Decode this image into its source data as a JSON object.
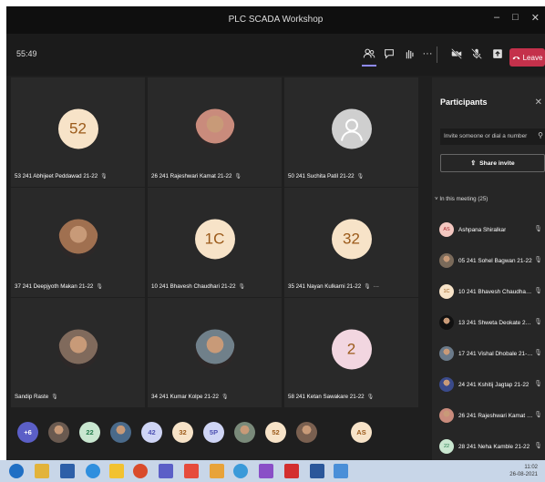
{
  "window": {
    "title": "PLC SCADA Workshop",
    "minimize": "–",
    "maximize": "□",
    "close": "✕"
  },
  "toolbar": {
    "timer": "55:49",
    "leave_label": "Leave"
  },
  "tiles": [
    {
      "label": "53 241 Abhijeet Peddawad 21-22",
      "initials": "52",
      "avatar_bg": "#f7e3c8",
      "kind": "initials"
    },
    {
      "label": "26 241 Rajeshwari Kamat 21-22",
      "initials": "",
      "avatar_bg": "#c98b7c",
      "kind": "photo"
    },
    {
      "label": "50 241 Suchita Patil 21-22",
      "initials": "",
      "avatar_bg": "#cfcfcf",
      "kind": "silhouette"
    },
    {
      "label": "37 241 Deepjyoth Makan 21-22",
      "initials": "",
      "avatar_bg": "#a07050",
      "kind": "photo"
    },
    {
      "label": "10 241 Bhavesh Chaudhari 21-22",
      "initials": "1C",
      "avatar_bg": "#f7e3c8",
      "kind": "initials"
    },
    {
      "label": "35 241 Nayan Kulkarni 21-22",
      "initials": "32",
      "avatar_bg": "#f7e3c8",
      "kind": "initials"
    },
    {
      "label": "Sandip Raste",
      "initials": "",
      "avatar_bg": "#806a5c",
      "kind": "photo"
    },
    {
      "label": "34 241 Kumar Kolpe 21-22",
      "initials": "",
      "avatar_bg": "#70808a",
      "kind": "photo"
    },
    {
      "label": "58 241 Ketan Sawakare 21-22",
      "initials": "2",
      "avatar_bg": "#f2d6e0",
      "kind": "initials"
    }
  ],
  "tile_more": "···",
  "strip": [
    {
      "text": "+6",
      "bg": "#5b5fc7",
      "fg": "#ffffff"
    },
    {
      "text": "",
      "bg": "#6a5a50",
      "fg": "#ffffff"
    },
    {
      "text": "22",
      "bg": "#c9e7d0",
      "fg": "#237b4b"
    },
    {
      "text": "",
      "bg": "#4a6a8a",
      "fg": "#ffffff"
    },
    {
      "text": "42",
      "bg": "#cfd5f5",
      "fg": "#4f52b2"
    },
    {
      "text": "32",
      "bg": "#f7e3c8",
      "fg": "#9b5a1a"
    },
    {
      "text": "5P",
      "bg": "#cfd5f5",
      "fg": "#4f52b2"
    },
    {
      "text": "",
      "bg": "#7a8a7a",
      "fg": "#ffffff"
    },
    {
      "text": "52",
      "bg": "#f7e3c8",
      "fg": "#9b5a1a"
    },
    {
      "text": "",
      "bg": "#7a6050",
      "fg": "#ffffff"
    },
    {
      "text": "AS",
      "bg": "#f7e3c8",
      "fg": "#9b5a1a"
    }
  ],
  "panel": {
    "title": "Participants",
    "close": "✕",
    "invite_placeholder": "Invite someone or dial a number",
    "share_label": "Share invite",
    "in_meeting": "In this meeting (25)",
    "participants": [
      {
        "name": "Ashpana Shiralkar",
        "initials": "AS",
        "bg": "#f3c7c0",
        "fg": "#a4262c"
      },
      {
        "name": "05 241 Sohel Bagwan 21-22",
        "initials": "",
        "bg": "#7a6a5a",
        "fg": "#ffffff"
      },
      {
        "name": "10 241 Bhavesh Chaudhari 21...",
        "initials": "1C",
        "bg": "#f7e3c8",
        "fg": "#9b5a1a"
      },
      {
        "name": "13 241 Shweta Deokate 21-22",
        "initials": "",
        "bg": "#111111",
        "fg": "#ffffff"
      },
      {
        "name": "17 241 Vishal Dhobale 21-22",
        "initials": "",
        "bg": "#6a7a8a",
        "fg": "#ffffff"
      },
      {
        "name": "24 241 Kshitij Jagtap 21-22",
        "initials": "",
        "bg": "#3a4a8a",
        "fg": "#ffffff"
      },
      {
        "name": "26 241 Rajeshwari Kamat 21-22",
        "initials": "",
        "bg": "#c98b7c",
        "fg": "#ffffff"
      },
      {
        "name": "28 241 Neha Kamble 21-22",
        "initials": "22",
        "bg": "#c9e7d0",
        "fg": "#237b4b"
      }
    ]
  },
  "taskbar": {
    "time": "11:02",
    "date": "26-08-2021"
  }
}
